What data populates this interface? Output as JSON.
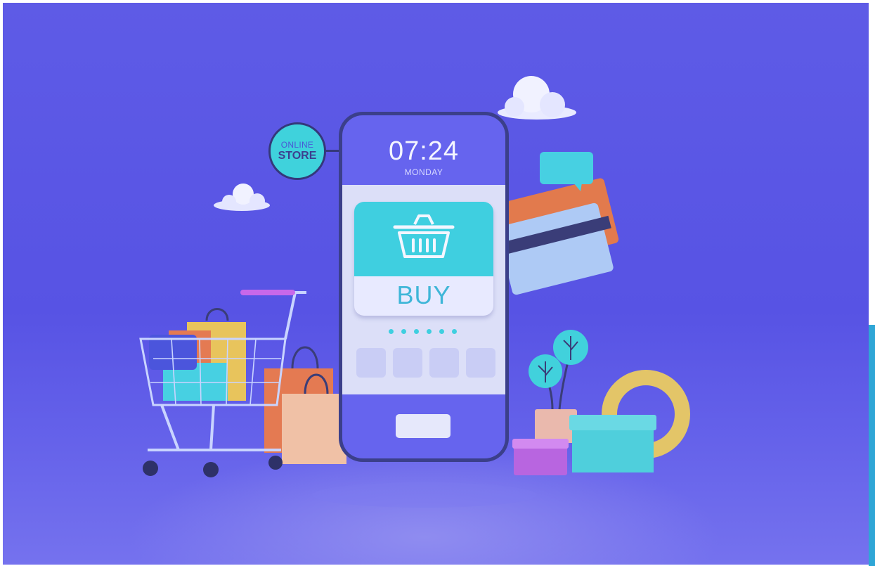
{
  "badge": {
    "line1": "ONLINE",
    "line2": "STORE"
  },
  "phone": {
    "time": "07:24",
    "day": "MONDAY",
    "buy_label": "BUY"
  },
  "icons": [
    "cloud-icon",
    "shopping-basket-icon",
    "shopping-cart-icon",
    "credit-card-icon",
    "chat-bubble-icon",
    "potted-plant-icon",
    "gift-box-icon",
    "ring-icon",
    "shopping-bag-icon"
  ],
  "colors": {
    "background": "#5e5be6",
    "phone_frame": "#3b3f8a",
    "phone_screen": "#6664ee",
    "accent_cyan": "#3fcfe0",
    "badge_text": "#3d3f8f",
    "bag_orange": "#e47a52",
    "bag_yellow": "#e6c65a",
    "card_orange": "#e27a4d",
    "card_blue": "#a9c8f4",
    "box_magenta": "#c26ee6",
    "ring_gold": "#e3c568"
  }
}
